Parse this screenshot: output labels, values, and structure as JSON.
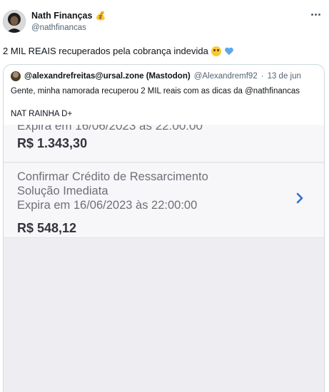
{
  "tweet": {
    "display_name": "Nath Finanças",
    "name_emoji": "💰",
    "handle": "@nathfinancas",
    "text": "2 MIL REAIS recuperados pela cobrança indevida",
    "text_emojis": [
      "pleading-face",
      "blue-heart"
    ]
  },
  "quote": {
    "display_name": "@alexandrefreitas@ursal.zone (Mastodon)",
    "handle": "@Alexandremf92",
    "separator": "·",
    "date": "13 de jun",
    "text_line1": "Gente, minha namorada recuperou 2 MIL reais com as dicas da @nathfinancas",
    "text_line2": "NAT RAINHA D+"
  },
  "screenshot": {
    "card1": {
      "partial_line": "Expira em 16/06/2023 às 22:00:00",
      "amount": "R$ 1.343,30"
    },
    "card2": {
      "title": "Confirmar Crédito de Ressarcimento",
      "subtitle": "Solução Imediata",
      "expiry": "Expira em 16/06/2023 às 22:00:00",
      "amount": "R$ 548,12"
    },
    "accent_color": "#2d6fce"
  }
}
